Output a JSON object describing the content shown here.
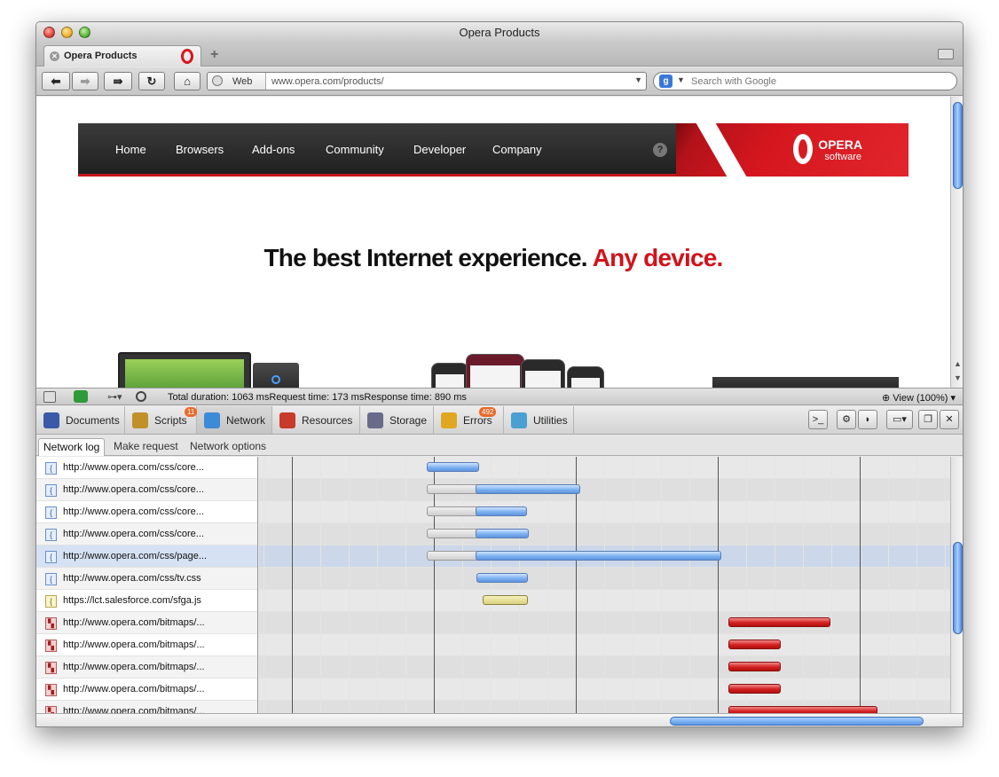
{
  "window": {
    "title": "Opera Products"
  },
  "tabs": [
    {
      "title": "Opera Products"
    }
  ],
  "toolbar": {
    "back": "⬅",
    "forward": "➡",
    "fastforward": "⇛",
    "reload": "↻",
    "home": "⌂",
    "address_scheme": "Web",
    "address_url": "www.opera.com/products/",
    "search_placeholder": "Search with Google",
    "search_engine_glyph": "g"
  },
  "site": {
    "nav": [
      "Home",
      "Browsers",
      "Add-ons",
      "Community",
      "Developer",
      "Company"
    ],
    "help": "?",
    "logo_line1": "OPERA",
    "logo_line2": "software",
    "headline": "The best Internet experience.",
    "headline_accent": "Any device."
  },
  "devtools": {
    "status": "Total duration: 1063 msRequest time: 173 msResponse time: 890 ms",
    "zoom": "View (100%)",
    "tabs": [
      {
        "label": "Documents",
        "color": "#3a5aa8"
      },
      {
        "label": "Scripts",
        "color": "#c0902a",
        "badge": "11"
      },
      {
        "label": "Network",
        "color": "#3d8ad8"
      },
      {
        "label": "Resources",
        "color": "#c83a2a"
      },
      {
        "label": "Storage",
        "color": "#6a6a8a"
      },
      {
        "label": "Errors",
        "color": "#e0a820",
        "badge": "492"
      },
      {
        "label": "Utilities",
        "color": "#4aa0d0"
      }
    ],
    "subtabs": [
      "Network log",
      "Make request",
      "Network options"
    ],
    "requests": [
      {
        "url": "http://www.opera.com/css/core...",
        "type": "css",
        "wait": 0,
        "start": 0.187,
        "end": 0.245
      },
      {
        "url": "http://www.opera.com/css/core...",
        "type": "css",
        "wait": 0.187,
        "start": 0.241,
        "end": 0.358
      },
      {
        "url": "http://www.opera.com/css/core...",
        "type": "css",
        "wait": 0.187,
        "start": 0.241,
        "end": 0.299
      },
      {
        "url": "http://www.opera.com/css/core...",
        "type": "css",
        "wait": 0.187,
        "start": 0.241,
        "end": 0.301
      },
      {
        "url": "http://www.opera.com/css/page...",
        "type": "css",
        "wait": 0.187,
        "start": 0.241,
        "end": 0.516,
        "selected": true
      },
      {
        "url": "http://www.opera.com/css/tv.css",
        "type": "css",
        "wait": 0,
        "start": 0.242,
        "end": 0.3
      },
      {
        "url": "https://lct.salesforce.com/sfga.js",
        "type": "js",
        "wait": 0,
        "start": 0.249,
        "end": 0.3
      },
      {
        "url": "http://www.opera.com/bitmaps/...",
        "type": "img",
        "wait": 0,
        "start": 0.523,
        "end": 0.637
      },
      {
        "url": "http://www.opera.com/bitmaps/...",
        "type": "img",
        "wait": 0,
        "start": 0.523,
        "end": 0.582
      },
      {
        "url": "http://www.opera.com/bitmaps/...",
        "type": "img",
        "wait": 0,
        "start": 0.523,
        "end": 0.582
      },
      {
        "url": "http://www.opera.com/bitmaps/...",
        "type": "img",
        "wait": 0,
        "start": 0.523,
        "end": 0.582
      },
      {
        "url": "http://www.opera.com/bitmaps/...",
        "type": "img",
        "wait": 0,
        "start": 0.523,
        "end": 0.69
      }
    ]
  }
}
